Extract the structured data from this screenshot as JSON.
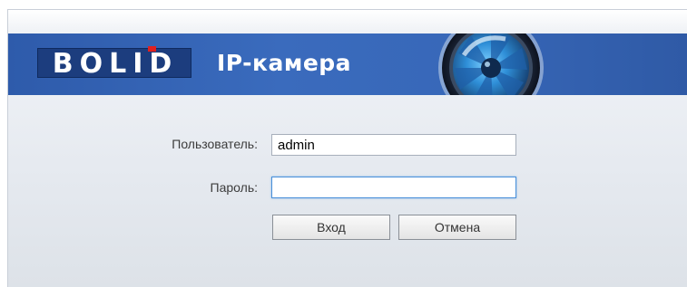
{
  "brand": {
    "logo_text": "BOLID",
    "product_title": "IP-камера"
  },
  "banner": {
    "icon": "camera-lens-icon",
    "colors": {
      "banner_blue": "#3566b6",
      "logo_dark_blue": "#1c3d7e",
      "logo_accent_red": "#e02020"
    }
  },
  "login_form": {
    "username_label": "Пользователь:",
    "username_value": "admin",
    "password_label": "Пароль:",
    "password_value": "",
    "login_button_label": "Вход",
    "cancel_button_label": "Отмена"
  }
}
